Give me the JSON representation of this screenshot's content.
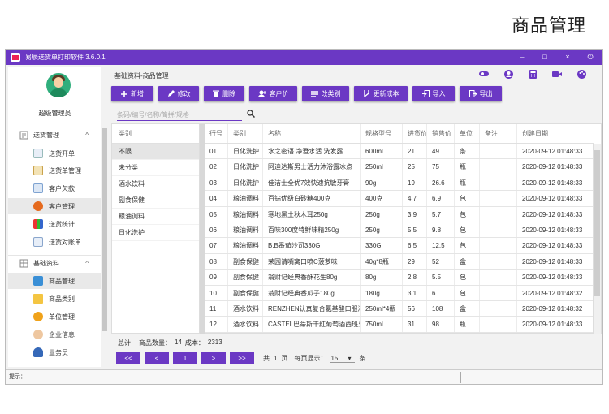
{
  "hero_title": "商品管理",
  "window": {
    "title": "易辰送货单打印软件 3.6.0.1",
    "controls": [
      "–",
      "□",
      "×",
      "⏻"
    ]
  },
  "sidebar": {
    "user": "超级管理员",
    "groups": [
      {
        "label": "送货管理",
        "items": [
          "送货开单",
          "送货单管理",
          "客户欠款",
          "客户管理",
          "送货统计",
          "送货对账单"
        ]
      },
      {
        "label": "基础资料",
        "items": [
          "商品管理",
          "商品类别",
          "单位管理",
          "企业信息",
          "业务员"
        ]
      }
    ],
    "selected": "商品管理"
  },
  "breadcrumb": "基础资料-商品管理",
  "toolbar": [
    "新增",
    "修改",
    "删除",
    "客户价",
    "改类别",
    "更新成本",
    "导入",
    "导出"
  ],
  "search": {
    "placeholder": "条码/编号/名称/简拼/规格"
  },
  "categories": {
    "header": "类别",
    "items": [
      "不限",
      "未分类",
      "酒水饮料",
      "副食保健",
      "粮油调料",
      "日化洗护"
    ],
    "selected": "不限"
  },
  "table": {
    "columns": [
      "行号",
      "类别",
      "名称",
      "规格型号",
      "进货价",
      "销售价",
      "单位",
      "备注",
      "创建日期"
    ],
    "rows": [
      [
        "01",
        "日化洗护",
        "水之密语 净澄水活 洗发露",
        "600ml",
        "21",
        "49",
        "条",
        "",
        "2020-09-12 01:48:33"
      ],
      [
        "02",
        "日化洗护",
        "阿迪达斯男士活力沐浴露冰点",
        "250ml",
        "25",
        "75",
        "瓶",
        "",
        "2020-09-12 01:48:33"
      ],
      [
        "03",
        "日化洗护",
        "佳洁士全优7效快速抗敏牙膏",
        "90g",
        "19",
        "26.6",
        "瓶",
        "",
        "2020-09-12 01:48:33"
      ],
      [
        "04",
        "粮油调料",
        "百钻优级白砂糖400克",
        "400克",
        "4.7",
        "6.9",
        "包",
        "",
        "2020-09-12 01:48:33"
      ],
      [
        "05",
        "粮油调料",
        "寒地黑土秋木耳250g",
        "250g",
        "3.9",
        "5.7",
        "包",
        "",
        "2020-09-12 01:48:33"
      ],
      [
        "06",
        "粮油调料",
        "百味300度特鲜味精250g",
        "250g",
        "5.5",
        "9.8",
        "包",
        "",
        "2020-09-12 01:48:33"
      ],
      [
        "07",
        "粮油调料",
        "B.B番茄沙司330G",
        "330G",
        "6.5",
        "12.5",
        "包",
        "",
        "2020-09-12 01:48:33"
      ],
      [
        "08",
        "副食保健",
        "荣园请嘴窝口喷C菠萝味",
        "40g*8瓶",
        "29",
        "52",
        "盒",
        "",
        "2020-09-12 01:48:33"
      ],
      [
        "09",
        "副食保健",
        "翁财记经典香酥花生80g",
        "80g",
        "2.8",
        "5.5",
        "包",
        "",
        "2020-09-12 01:48:33"
      ],
      [
        "10",
        "副食保健",
        "翁财记经典香瓜子180g",
        "180g",
        "3.1",
        "6",
        "包",
        "",
        "2020-09-12 01:48:32"
      ],
      [
        "11",
        "酒水饮料",
        "RENZHEN认真复合氨基酸口服液",
        "250ml*4瓶",
        "56",
        "108",
        "盒",
        "",
        "2020-09-12 01:48:32"
      ],
      [
        "12",
        "酒水饮料",
        "CASTEL巴蒂斯干红葡萄酒西班牙",
        "750ml",
        "31",
        "98",
        "瓶",
        "",
        "2020-09-12 01:48:33"
      ]
    ]
  },
  "summary": {
    "label": "总计",
    "count_label": "商品数量：",
    "count": "14",
    "cost_label": "成本：",
    "cost": "2313"
  },
  "pager": {
    "first": "<<",
    "prev": "<",
    "page": "1",
    "next": ">",
    "last": ">>",
    "total_prefix": "共",
    "total_pages": "1",
    "total_suffix": "页",
    "per_page_label": "每页显示：",
    "per_page": "15",
    "per_page_suffix": "条"
  },
  "status": {
    "label": "提示："
  },
  "colors": {
    "accent": "#6b38c4"
  }
}
